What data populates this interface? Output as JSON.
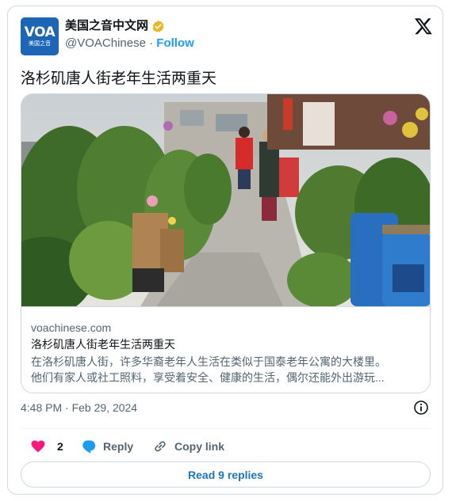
{
  "author": {
    "avatar_logo": "VOA",
    "avatar_sub": "美国之音",
    "display_name": "美国之音中文网",
    "handle": "@VOAChinese",
    "separator": " · ",
    "follow_label": "Follow"
  },
  "tweet": {
    "text": "洛杉矶唐人街老年生活两重天"
  },
  "link_card": {
    "domain": "voachinese.com",
    "title": "洛杉矶唐人街老年生活两重天",
    "description_line1": "在洛杉矶唐人街，许多华裔老年人生活在类似于国泰老年公寓的大楼里。",
    "description_line2": "他们有家人或社工照料，享受着安全、健康的生活，偶尔还能外出游玩..."
  },
  "meta": {
    "timestamp": "4:48 PM · Feb 29, 2024"
  },
  "actions": {
    "like_count": "2",
    "reply_label": "Reply",
    "copy_link_label": "Copy link"
  },
  "read_replies_label": "Read 9 replies",
  "colors": {
    "brand_blue": "#1d9bf0",
    "like_pink": "#f91880",
    "voa_blue": "#1d66b5",
    "verified_gold": "#e8b829"
  },
  "icons": [
    "verified-badge-icon",
    "x-logo-icon",
    "info-icon",
    "heart-icon",
    "reply-icon",
    "link-icon"
  ]
}
